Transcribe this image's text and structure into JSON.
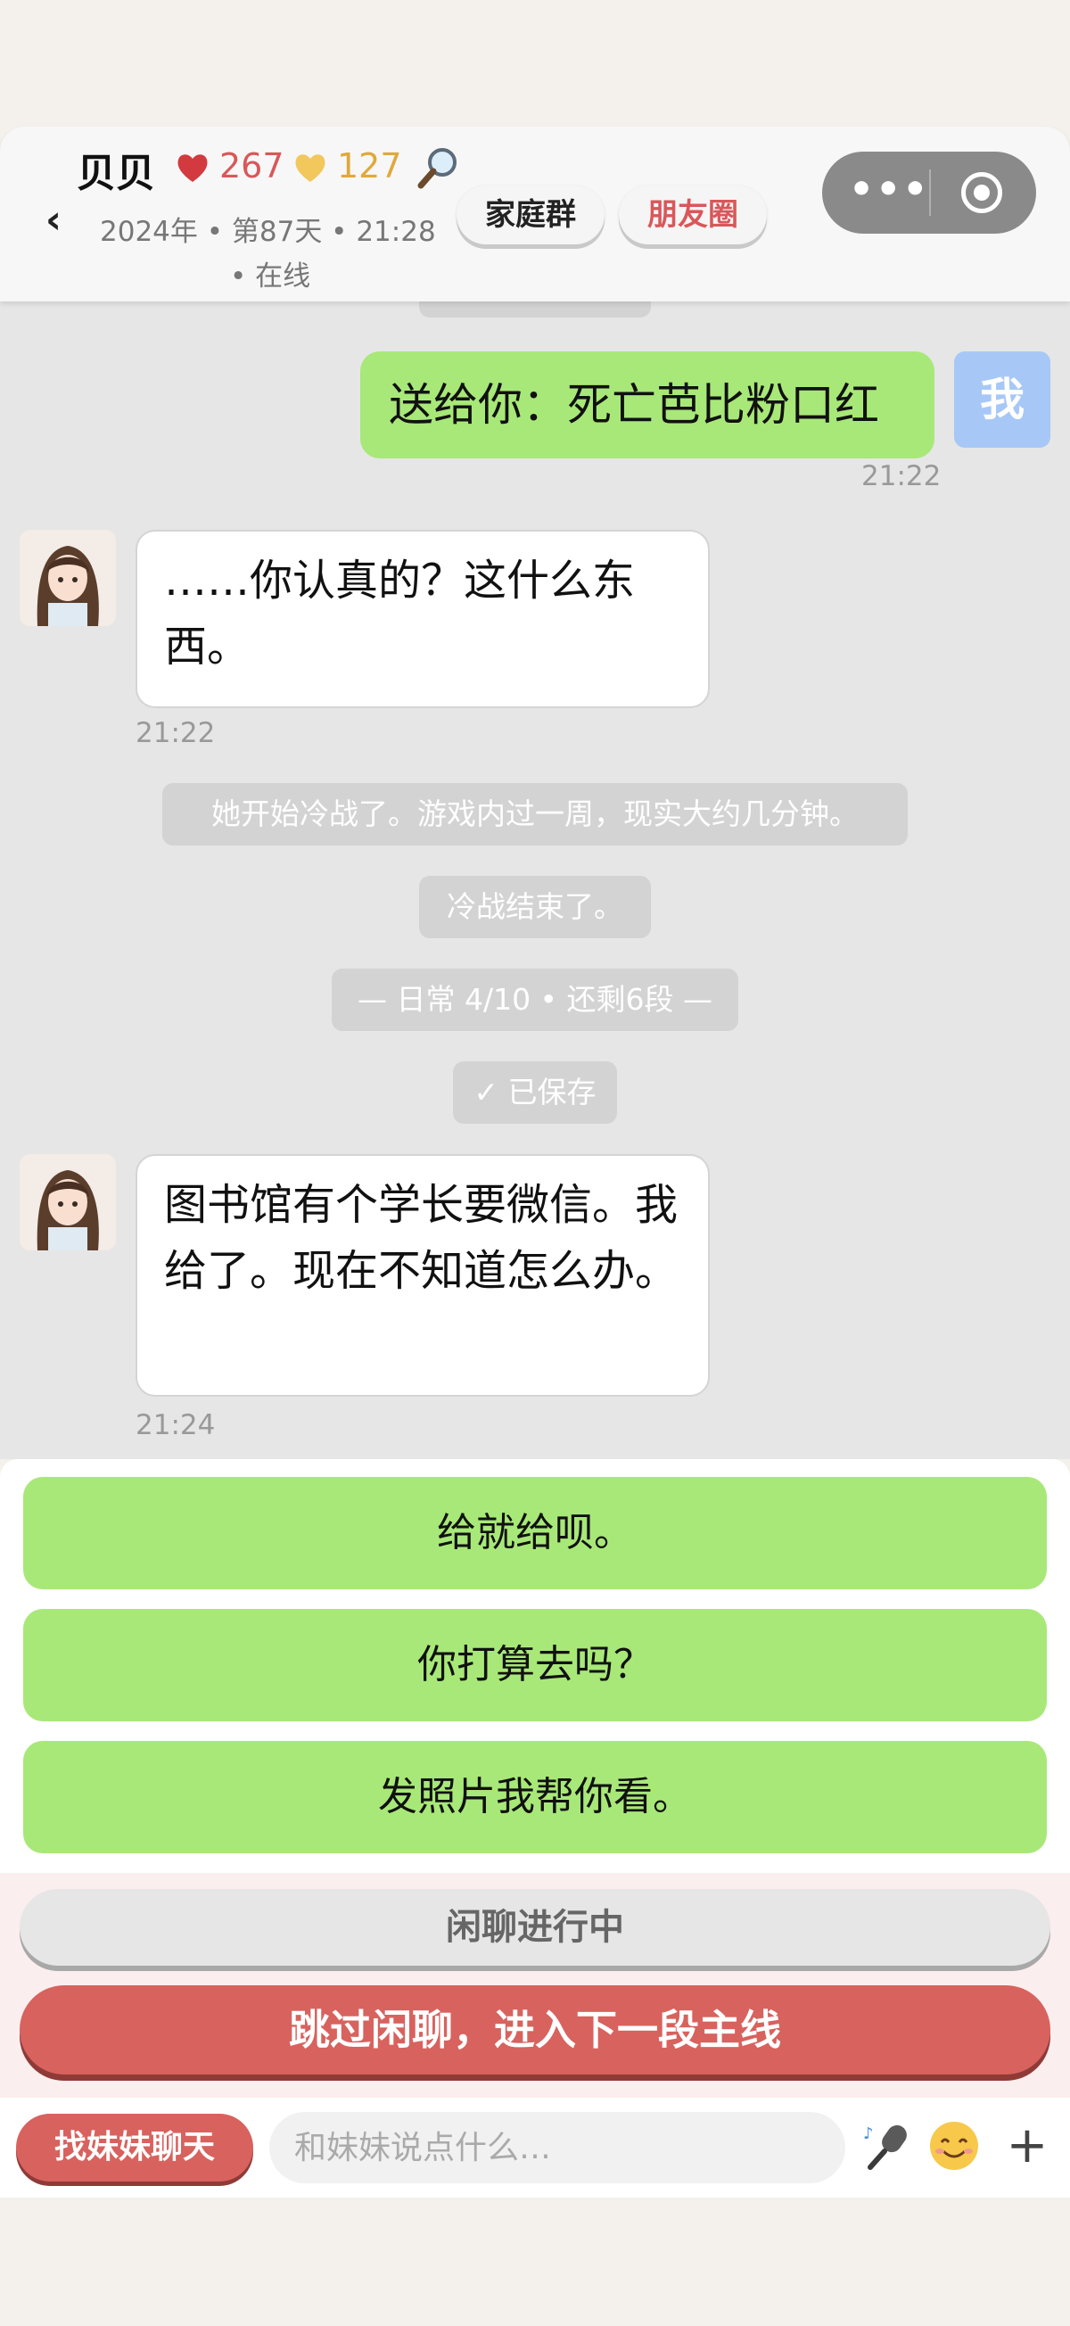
{
  "header": {
    "back_label": "‹",
    "name": "贝贝",
    "heart_value": "267",
    "gold_value": "127",
    "meta_line1": "2024年 • 第87天 • 21:28",
    "meta_line2": "• 在线",
    "pill_family": "家庭群",
    "pill_moments": "朋友圈",
    "capsule_dots": "•••"
  },
  "chat": {
    "my_avatar_label": "我",
    "messages": [
      {
        "from": "me",
        "text": "送给你：死亡芭比粉口红",
        "time": "21:22"
      },
      {
        "from": "her",
        "text": "……你认真的？这什么东西。",
        "time": "21:22"
      },
      {
        "from": "her",
        "text": "图书馆有个学长要微信。我给了。现在不知道怎么办。",
        "time": "21:24"
      }
    ],
    "system": [
      "她开始冷战了。游戏内过一周，现实大约几分钟。",
      "冷战结束了。",
      "— 日常 4/10 • 还剩6段 —",
      "✓ 已保存"
    ]
  },
  "options": [
    "给就给呗。",
    "你打算去吗？",
    "发照片我帮你看。"
  ],
  "actions": {
    "chatting": "闲聊进行中",
    "skip": "跳过闲聊，进入下一段主线"
  },
  "input_bar": {
    "find_button": "找妹妹聊天",
    "placeholder": "和妹妹说点什么…",
    "plus": "+"
  },
  "colors": {
    "my_bubble": "#a8e878",
    "accent_red": "#d8625e",
    "heart": "#d9575a",
    "gold": "#e0a83c",
    "my_avatar": "#a7c8f7"
  }
}
